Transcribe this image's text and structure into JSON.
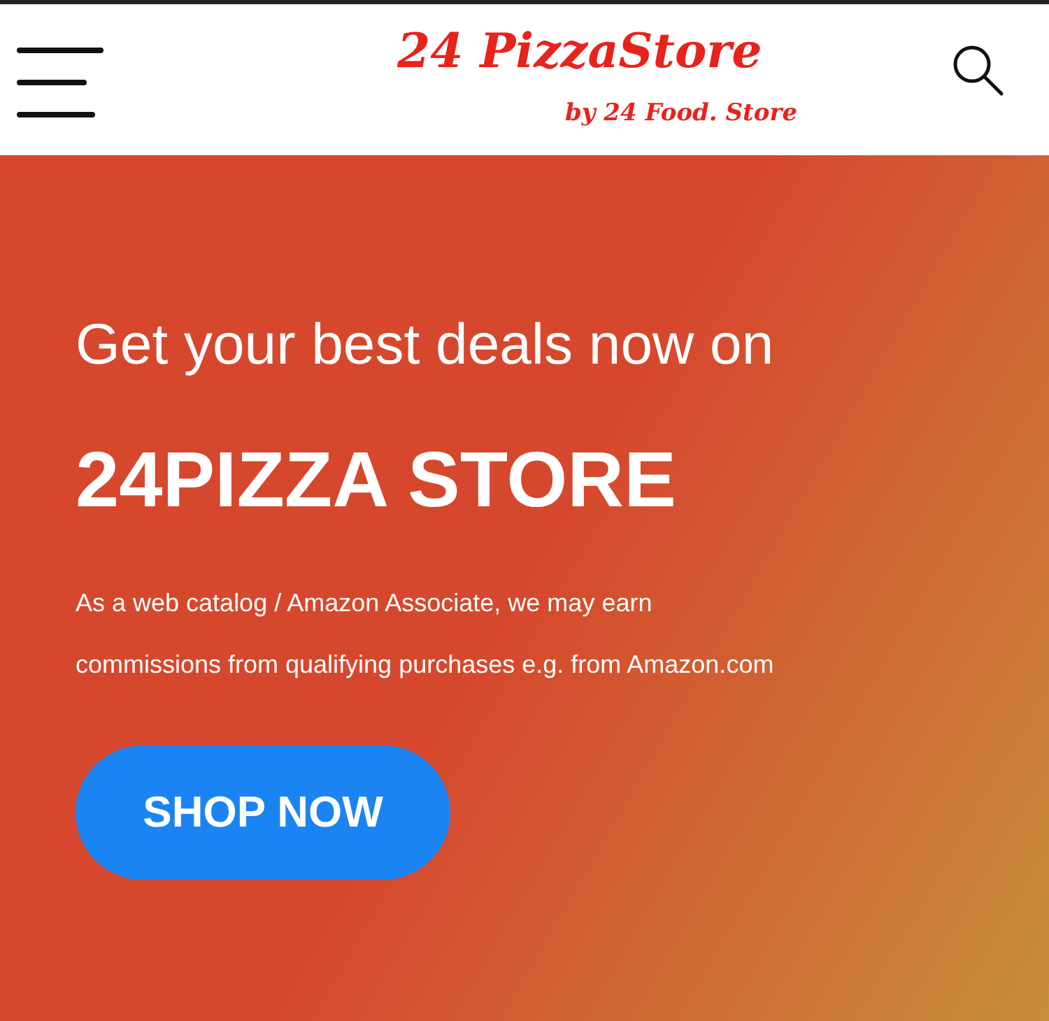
{
  "header": {
    "logo_title": "24 PizzaStore",
    "logo_subtitle": "by 24 Food. Store"
  },
  "hero": {
    "kicker": "Get your best deals now on",
    "title": "24PIZZA STORE",
    "disclaimer_lines": [
      "As a web catalog / Amazon Associate, we may earn",
      "commissions from qualifying purchases e.g. from Amazon.com"
    ],
    "button": "SHOP NOW"
  }
}
